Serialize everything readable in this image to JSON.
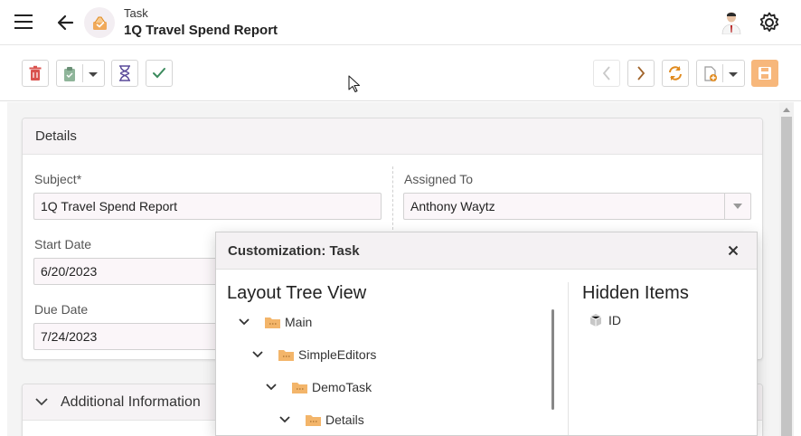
{
  "header": {
    "subtitle": "Task",
    "title": "1Q Travel Spend Report"
  },
  "details": {
    "section_title": "Details",
    "subject_label": "Subject*",
    "subject_value": "1Q Travel Spend Report",
    "assigned_label": "Assigned To",
    "assigned_value": "Anthony Waytz",
    "start_label": "Start Date",
    "start_value": "6/20/2023",
    "due_label": "Due Date",
    "due_value": "7/24/2023"
  },
  "additional": {
    "section_title": "Additional Information"
  },
  "dialog": {
    "title": "Customization: Task",
    "tree_title": "Layout Tree View",
    "hidden_title": "Hidden Items",
    "tree_items": [
      "Main",
      "SimpleEditors",
      "DemoTask",
      "Details"
    ],
    "hidden_items": [
      "ID"
    ]
  },
  "colors": {
    "accent": "#f7b77b",
    "folder": "#f3b56a",
    "delete": "#d9534f",
    "check": "#3a8a5c",
    "hourglass": "#5a4a9a",
    "refresh": "#e08a1e"
  },
  "icons": [
    "menu-icon",
    "back-arrow-icon",
    "task-app-icon",
    "user-avatar-icon",
    "gear-icon",
    "trash-icon",
    "clipboard-icon",
    "hourglass-icon",
    "check-icon",
    "chevron-left-icon",
    "chevron-right-icon",
    "refresh-icon",
    "new-document-icon",
    "save-icon",
    "close-icon",
    "folder-icon",
    "cube-icon"
  ]
}
